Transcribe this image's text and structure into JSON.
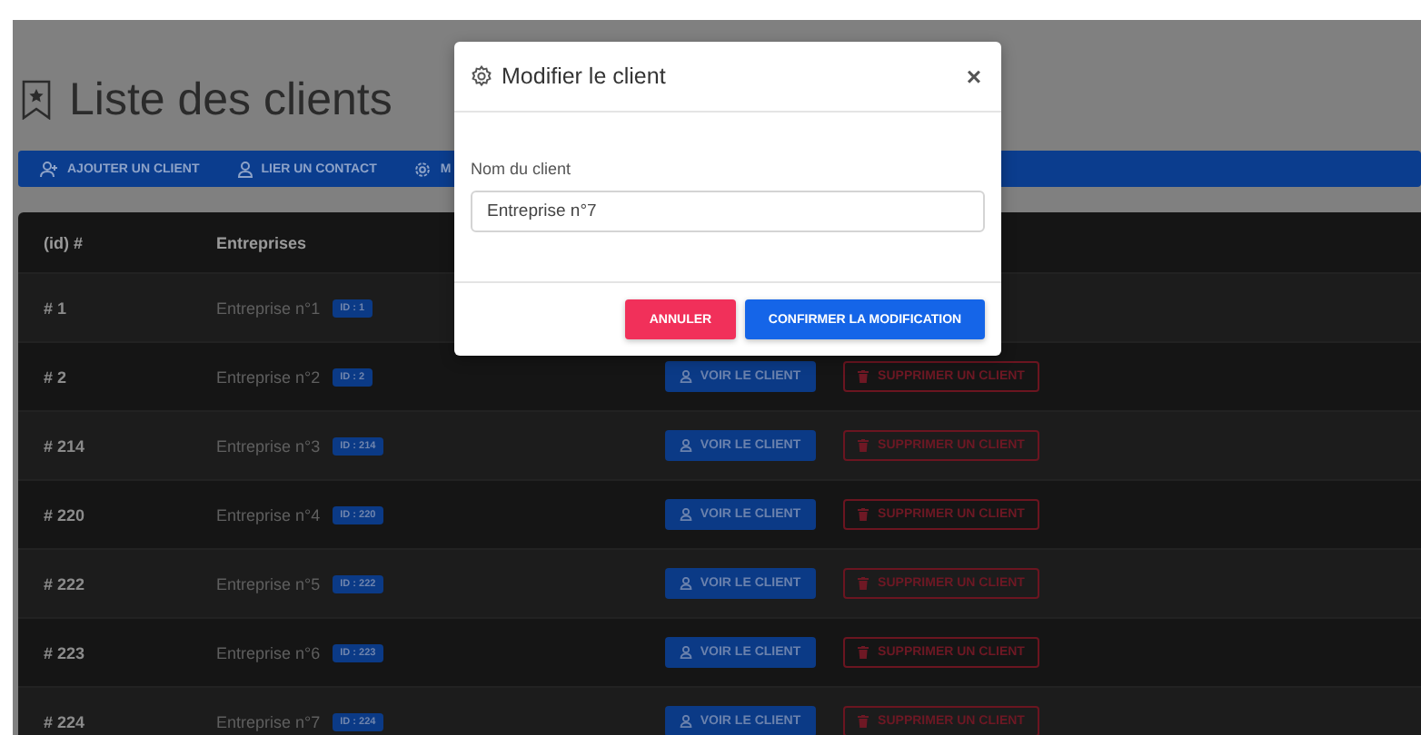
{
  "page": {
    "title": "Liste des clients"
  },
  "toolbar": [
    {
      "kind": "user-plus",
      "label": "AJOUTER UN CLIENT"
    },
    {
      "kind": "user",
      "label": "LIER UN CONTACT"
    },
    {
      "kind": "gear",
      "label": "M"
    }
  ],
  "table": {
    "columns": [
      "(id) #",
      "Entreprises"
    ],
    "rows": [
      {
        "id": "# 1",
        "name": "Entreprise n°1",
        "badge": "ID : 1"
      },
      {
        "id": "# 2",
        "name": "Entreprise n°2",
        "badge": "ID : 2",
        "view": "VOIR LE CLIENT",
        "delete": "SUPPRIMER UN CLIENT"
      },
      {
        "id": "# 214",
        "name": "Entreprise n°3",
        "badge": "ID : 214",
        "view": "VOIR LE CLIENT",
        "delete": "SUPPRIMER UN CLIENT"
      },
      {
        "id": "# 220",
        "name": "Entreprise n°4",
        "badge": "ID : 220",
        "view": "VOIR LE CLIENT",
        "delete": "SUPPRIMER UN CLIENT"
      },
      {
        "id": "# 222",
        "name": "Entreprise n°5",
        "badge": "ID : 222",
        "view": "VOIR LE CLIENT",
        "delete": "SUPPRIMER UN CLIENT"
      },
      {
        "id": "# 223",
        "name": "Entreprise n°6",
        "badge": "ID : 223",
        "view": "VOIR LE CLIENT",
        "delete": "SUPPRIMER UN CLIENT"
      },
      {
        "id": "# 224",
        "name": "Entreprise n°7",
        "badge": "ID : 224",
        "view": "VOIR LE CLIENT",
        "delete": "SUPPRIMER UN CLIENT"
      }
    ]
  },
  "modal": {
    "title": "Modifier le client",
    "close": "×",
    "field_label": "Nom du client",
    "field_value": "Entreprise n°7",
    "buttons": [
      {
        "kind": "cancel",
        "label": "ANNULER"
      },
      {
        "kind": "confirm",
        "label": "CONFIRMER LA MODIFICATION"
      }
    ]
  }
}
